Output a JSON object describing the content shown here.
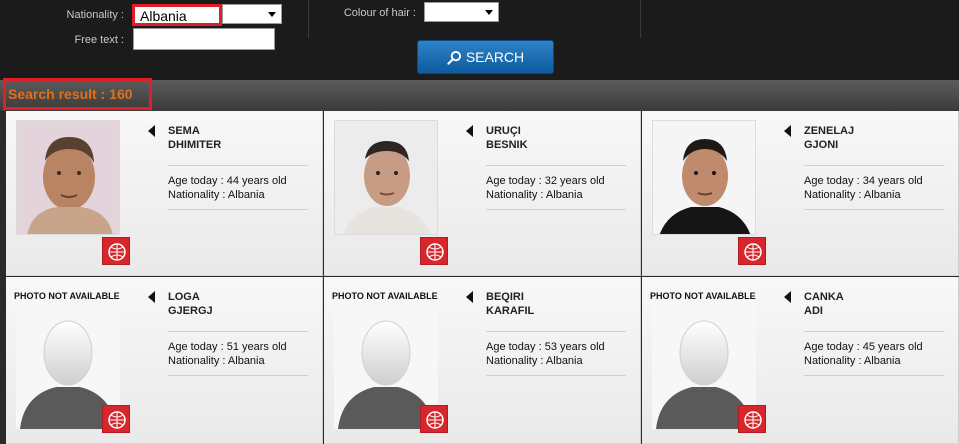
{
  "search_form": {
    "nationality_label": "Nationality :",
    "nationality_value": "Albania",
    "colour_of_hair_label": "Colour of hair :",
    "free_text_label": "Free text :",
    "free_text_value": "",
    "search_button_label": "SEARCH"
  },
  "results": {
    "count_text": "Search result : 160"
  },
  "colors": {
    "highlight": "#e01e28",
    "result_text": "#e0701c",
    "button_blue": "#1a6db5",
    "badge_red": "#d7262c"
  },
  "cards": [
    {
      "last_name": "SEMA",
      "first_name": "DHIMITER",
      "age": "Age today : 44 years old",
      "nationality": "Nationality : Albania",
      "photo_available": true,
      "photo_note": ""
    },
    {
      "last_name": "URUÇI",
      "first_name": "BESNIK",
      "age": "Age today : 32 years old",
      "nationality": "Nationality : Albania",
      "photo_available": true,
      "photo_note": ""
    },
    {
      "last_name": "ZENELAJ",
      "first_name": "GJONI",
      "age": "Age today : 34 years old",
      "nationality": "Nationality : Albania",
      "photo_available": true,
      "photo_note": ""
    },
    {
      "last_name": "LOGA",
      "first_name": "GJERGJ",
      "age": "Age today : 51 years old",
      "nationality": "Nationality : Albania",
      "photo_available": false,
      "photo_note": "PHOTO NOT AVAILABLE"
    },
    {
      "last_name": "BEQIRI",
      "first_name": "KARAFIL",
      "age": "Age today : 53 years old",
      "nationality": "Nationality : Albania",
      "photo_available": false,
      "photo_note": "PHOTO NOT AVAILABLE"
    },
    {
      "last_name": "CANKA",
      "first_name": "ADI",
      "age": "Age today : 45 years old",
      "nationality": "Nationality : Albania",
      "photo_available": false,
      "photo_note": "PHOTO NOT AVAILABLE"
    }
  ]
}
